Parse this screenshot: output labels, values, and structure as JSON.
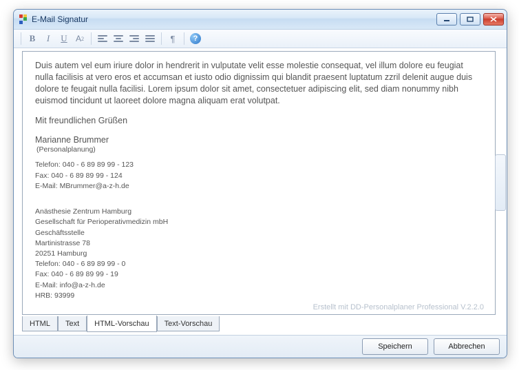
{
  "window": {
    "title": "E-Mail Signatur"
  },
  "toolbar": {
    "bold": "B",
    "italic": "I",
    "underline": "U",
    "font_size": "A",
    "pilcrow": "¶",
    "help": "?"
  },
  "preview": {
    "paragraph": "Duis autem vel eum iriure dolor in hendrerit in vulputate velit esse molestie consequat, vel illum dolore eu feugiat nulla facilisis at vero eros et accumsan et iusto odio dignissim qui blandit praesent luptatum zzril delenit augue duis dolore te feugait nulla facilisi. Lorem ipsum dolor sit amet, consectetuer adipiscing elit, sed diam nonummy nibh euismod tincidunt ut laoreet dolore magna aliquam erat volutpat.",
    "closing": "Mit freundlichen Grüßen",
    "name": "Marianne Brummer",
    "department": "(Personalplanung)",
    "contact_block": "Telefon: 040 - 6 89 89 99 - 123\nFax: 040 - 6 89 89 99 - 124\nE-Mail: MBrummer@a-z-h.de",
    "company_block": "Anästhesie Zentrum Hamburg\nGesellschaft für Perioperativmedizin mbH\nGeschäftsstelle\nMartinistrasse 78\n20251 Hamburg\nTelefon: 040 - 6 89 89 99 - 0\nFax: 040 - 6 89 89 99 - 19\nE-Mail: info@a-z-h.de\nHRB: 93999",
    "watermark": "Erstellt mit DD-Personalplaner Professional V.2.2.0"
  },
  "tabs": {
    "html": "HTML",
    "text": "Text",
    "html_preview": "HTML-Vorschau",
    "text_preview": "Text-Vorschau"
  },
  "footer": {
    "save": "Speichern",
    "cancel": "Abbrechen"
  }
}
